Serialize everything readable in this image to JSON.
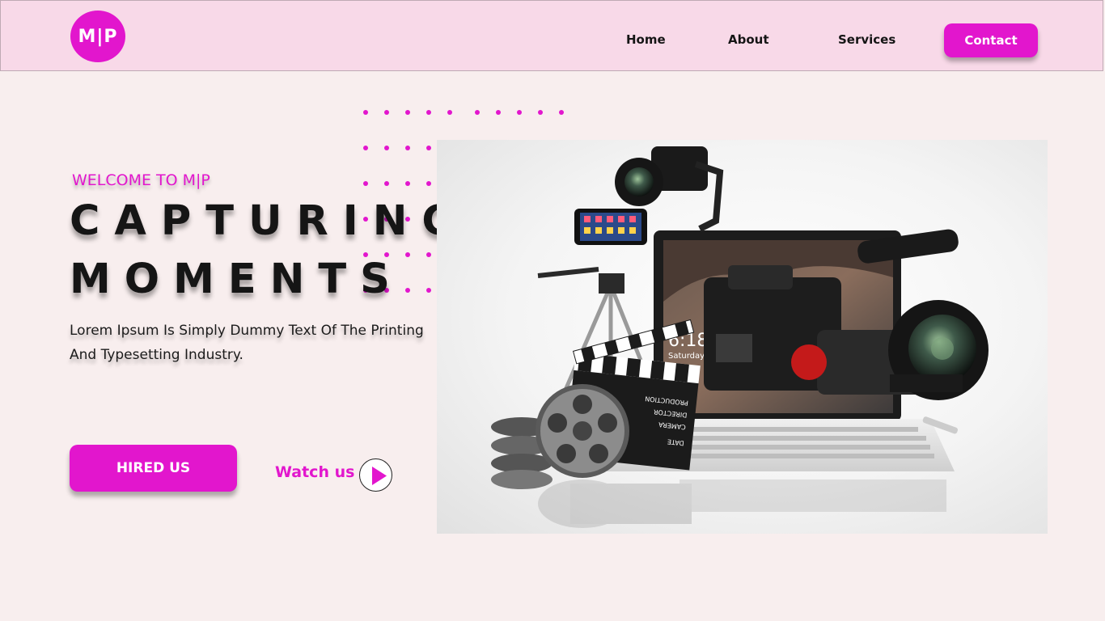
{
  "header": {
    "logo_text": "M|P",
    "nav": {
      "home": "Home",
      "about": "About",
      "services": "Services",
      "contact": "Contact"
    }
  },
  "hero": {
    "welcome": "WELCOME  TO M|P",
    "headline_line1": "CAPTURING",
    "headline_line2": "MOMENTS",
    "tagline": "Lorem Ipsum Is Simply Dummy Text Of The Printing And Typesetting Industry.",
    "hire_label": "HIRED US",
    "watch_label": "Watch us"
  },
  "hero_image": {
    "laptop_time": "6:18",
    "laptop_day": "Saturday",
    "clapper_labels": [
      "PRODUCTION",
      "DIRECTOR",
      "CAMERA",
      "DATE"
    ]
  },
  "icons": {
    "play": "play-icon"
  },
  "colors": {
    "accent": "#e216cd",
    "nav_bg": "#f8d9e8",
    "page_bg": "#f8eeee",
    "text": "#151515"
  }
}
